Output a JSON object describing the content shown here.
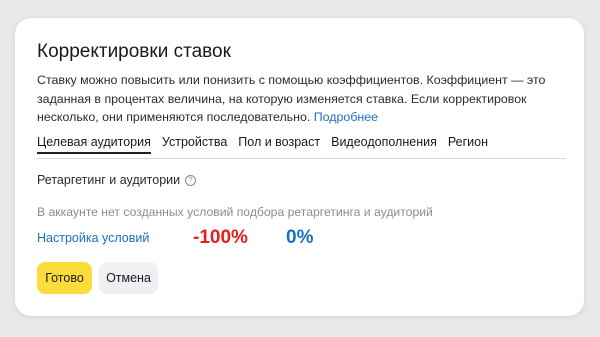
{
  "dialog": {
    "title": "Корректировки ставок",
    "description": "Ставку можно повысить или понизить с помощью коэффициентов. Коэффициент — это заданная в процентах величина, на которую изменяется ставка. Если корректировок несколько, они применяются последовательно.",
    "more_link": "Подробнее"
  },
  "tabs": [
    {
      "label": "Целевая аудитория",
      "active": true
    },
    {
      "label": "Устройства",
      "active": false
    },
    {
      "label": "Пол и возраст",
      "active": false
    },
    {
      "label": "Видеодополнения",
      "active": false
    },
    {
      "label": "Регион",
      "active": false
    }
  ],
  "section": {
    "label": "Ретаргетинг и аудитории",
    "help_icon": "question-circle-icon",
    "empty_note": "В аккаунте нет созданных условий подбора ретаргетинга и аудиторий",
    "settings_link": "Настройка условий",
    "value_min": "-100%",
    "value_max": "0%"
  },
  "buttons": {
    "done": "Готово",
    "cancel": "Отмена"
  },
  "colors": {
    "accent_yellow": "#fcdc3a",
    "link_blue": "#1a6fc4",
    "negative_red": "#e0201b"
  }
}
